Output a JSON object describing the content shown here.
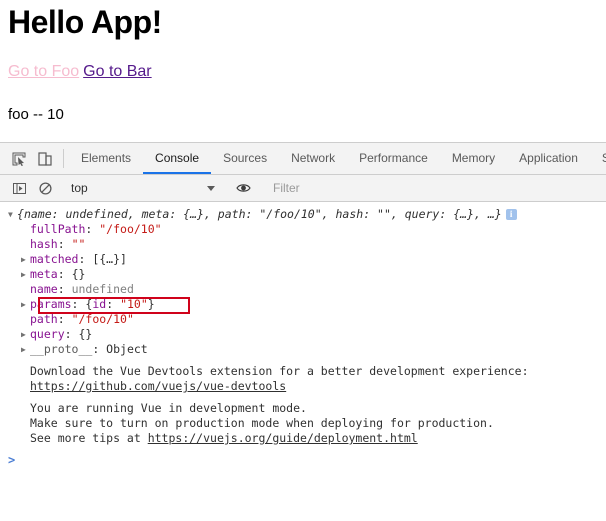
{
  "page": {
    "title": "Hello App!",
    "link_foo": "Go to Foo",
    "link_bar": "Go to Bar",
    "route_text": "foo -- 10",
    "colors": {
      "link_foo": "#f6bccf",
      "link_bar": "#551a8b"
    }
  },
  "devtools": {
    "icons": {
      "inspect": "inspect-element-icon",
      "device": "device-toolbar-icon",
      "sidebar": "console-sidebar-icon",
      "clear": "clear-console-icon",
      "eye": "live-expression-eye-icon"
    },
    "tabs": [
      {
        "label": "Elements",
        "active": false
      },
      {
        "label": "Console",
        "active": true
      },
      {
        "label": "Sources",
        "active": false
      },
      {
        "label": "Network",
        "active": false
      },
      {
        "label": "Performance",
        "active": false
      },
      {
        "label": "Memory",
        "active": false
      },
      {
        "label": "Application",
        "active": false
      },
      {
        "label": "Sec",
        "active": false
      }
    ],
    "toolbar": {
      "context": "top",
      "filter_placeholder": "Filter"
    },
    "active_tab_underline_color": "#1a73e8"
  },
  "console": {
    "object_preview": {
      "open": "{",
      "text": "name: undefined, meta: {…}, path: \"/foo/10\", hash: \"\", query: {…}, …}",
      "info_badge": "i"
    },
    "properties": [
      {
        "expandable": false,
        "name": "fullPath",
        "value": "\"/foo/10\"",
        "kind": "string"
      },
      {
        "expandable": false,
        "name": "hash",
        "value": "\"\"",
        "kind": "string"
      },
      {
        "expandable": true,
        "name": "matched",
        "value": "[{…}]",
        "kind": "object"
      },
      {
        "expandable": true,
        "name": "meta",
        "value": "{}",
        "kind": "object"
      },
      {
        "expandable": false,
        "name": "name",
        "value": "undefined",
        "kind": "undefined"
      },
      {
        "expandable": true,
        "name": "params",
        "value": "{id: \"10\"}",
        "kind": "object-with-string",
        "highlighted": true
      },
      {
        "expandable": false,
        "name": "path",
        "value": "\"/foo/10\"",
        "kind": "string"
      },
      {
        "expandable": true,
        "name": "query",
        "value": "{}",
        "kind": "object"
      },
      {
        "expandable": true,
        "name": "__proto__",
        "value": "Object",
        "kind": "proto"
      }
    ],
    "params_inner": {
      "open": "{",
      "key": "id",
      "colon": ": ",
      "value": "\"10\"",
      "close": "}"
    },
    "annotation": {
      "type": "red-rectangle",
      "color": "#d0021b",
      "target": "params"
    },
    "messages": [
      {
        "id": "vue-devtools",
        "lines": [
          "Download the Vue Devtools extension for a better development experience:",
          "https://github.com/vuejs/vue-devtools"
        ],
        "link_line_index": 1
      },
      {
        "id": "vue-dev-mode",
        "lines": [
          "You are running Vue in development mode.",
          "Make sure to turn on production mode when deploying for production.",
          "See more tips at https://vuejs.org/guide/deployment.html"
        ],
        "inline_link": "https://vuejs.org/guide/deployment.html",
        "inline_link_prefix": "See more tips at "
      }
    ],
    "prompt": ">"
  }
}
